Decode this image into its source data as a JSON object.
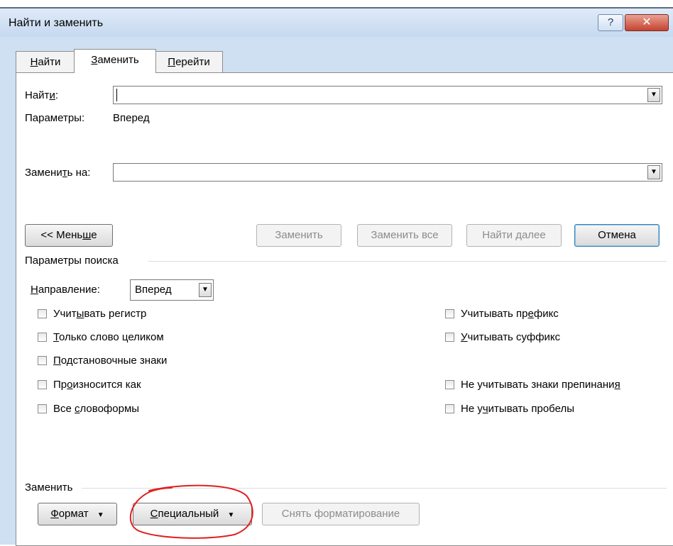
{
  "window": {
    "title": "Найти и заменить",
    "help_glyph": "?",
    "close_glyph": "✕"
  },
  "tabs": [
    {
      "label": "Найти",
      "key": "Н",
      "rest": "айти"
    },
    {
      "label": "Заменить",
      "key": "З",
      "rest": "аменить"
    },
    {
      "label": "Перейти",
      "key": "П",
      "rest": "ерейти"
    }
  ],
  "find": {
    "label_pre": "Найт",
    "label_key": "и",
    "label_post": ":",
    "value": ""
  },
  "params": {
    "label": "Параметры:",
    "value": "Вперед"
  },
  "replace": {
    "label_pre": "Замени",
    "label_key": "т",
    "label_post": "ь на:",
    "value": ""
  },
  "buttons": {
    "less": {
      "pre": "<< Мень",
      "key": "ш",
      "post": "е"
    },
    "replace": "Заменить",
    "replace_all": "Заменить все",
    "find_next": "Найти далее",
    "cancel": "Отмена"
  },
  "search_options": {
    "title": "Параметры поиска",
    "direction": {
      "label_key": "Н",
      "label_rest": "аправление:",
      "value": "Вперед"
    },
    "left": [
      {
        "pre": "Учит",
        "key": "ы",
        "post": "вать регистр",
        "checked": false
      },
      {
        "pre": "",
        "key": "Т",
        "post": "олько слово целиком",
        "checked": false
      },
      {
        "pre": "",
        "key": "П",
        "post": "одстановочные знаки",
        "checked": false
      },
      {
        "pre": "Пр",
        "key": "о",
        "post": "износится как",
        "checked": false
      },
      {
        "pre": "Все ",
        "key": "с",
        "post": "ловоформы",
        "checked": false
      }
    ],
    "right": [
      {
        "pre": "Учитывать пр",
        "key": "е",
        "post": "фикс",
        "checked": false
      },
      {
        "pre": "",
        "key": "У",
        "post": "читывать суффикс",
        "checked": false
      },
      {
        "pre": "Не учитывать знаки препинани",
        "key": "я",
        "post": "",
        "checked": false
      },
      {
        "pre": "Не у",
        "key": "ч",
        "post": "итывать пробелы",
        "checked": false
      }
    ]
  },
  "replace_section": {
    "title": "Заменить",
    "format": {
      "key": "Ф",
      "rest": "ормат"
    },
    "special": {
      "key": "С",
      "rest": "пециальный"
    },
    "clear": "Снять форматирование",
    "dropdown_glyph": "▼"
  },
  "colors": {
    "annotation": "#e02020",
    "window_frame": "#cfe0f3",
    "close_red": "#c5432f"
  }
}
